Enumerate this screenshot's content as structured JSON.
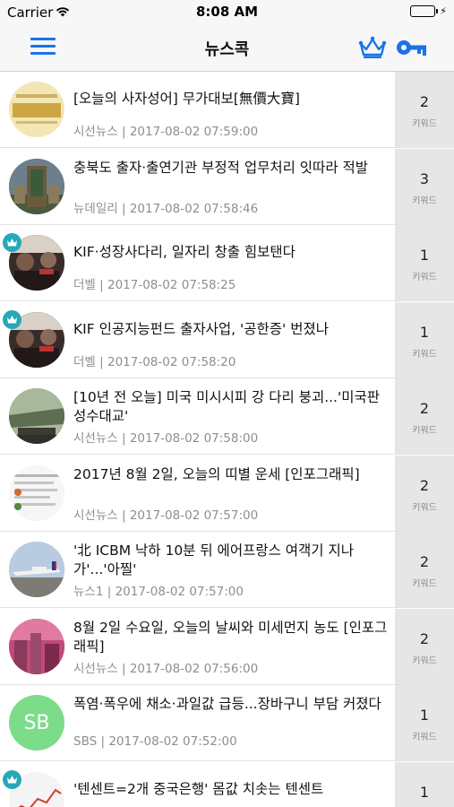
{
  "status_bar": {
    "carrier": "Carrier",
    "time": "8:08 AM"
  },
  "nav": {
    "title": "뉴스콕",
    "menu_icon": "hamburger-menu-icon",
    "crown_icon": "crown-icon",
    "key_icon": "key-icon"
  },
  "colors": {
    "accent": "#1a73e8",
    "badge": "#25a9b8",
    "keyword_bg": "#e6e6e6",
    "meta_text": "#8e8e8e"
  },
  "articles": [
    {
      "title": "[오늘의 사자성어] 무가대보[無價大寶]",
      "source": "시선뉴스",
      "time": "2017-08-02 07:59:00",
      "keyword_count": "2",
      "keyword_label": "키워드",
      "premium": false,
      "thumb_text": "",
      "thumb_bg": "#f3e6b5"
    },
    {
      "title": "충북도 출자·출연기관 부정적 업무처리 잇따라 적발",
      "source": "뉴데일리",
      "time": "2017-08-02 07:58:46",
      "keyword_count": "3",
      "keyword_label": "키워드",
      "premium": false,
      "thumb_text": "",
      "thumb_bg": "#4b5a3e"
    },
    {
      "title": "KIF·성장사다리, 일자리 창출 힘보탠다",
      "source": "더벨",
      "time": "2017-08-02 07:58:25",
      "keyword_count": "1",
      "keyword_label": "키워드",
      "premium": true,
      "thumb_text": "",
      "thumb_bg": "#3a2b2b"
    },
    {
      "title": "KIF 인공지능펀드 출자사업, '공한증' 번졌나",
      "source": "더벨",
      "time": "2017-08-02 07:58:20",
      "keyword_count": "1",
      "keyword_label": "키워드",
      "premium": true,
      "thumb_text": "",
      "thumb_bg": "#3a2b2b"
    },
    {
      "title": "[10년 전 오늘] 미국 미시시피 강 다리 붕괴...'미국판 성수대교'",
      "source": "시선뉴스",
      "time": "2017-08-02 07:58:00",
      "keyword_count": "2",
      "keyword_label": "키워드",
      "premium": false,
      "thumb_text": "",
      "thumb_bg": "#6f8a62"
    },
    {
      "title": "2017년 8월 2일, 오늘의 띠별 운세 [인포그래픽]",
      "source": "시선뉴스",
      "time": "2017-08-02 07:57:00",
      "keyword_count": "2",
      "keyword_label": "키워드",
      "premium": false,
      "thumb_text": "",
      "thumb_bg": "#f2f2f2"
    },
    {
      "title": "'北 ICBM 낙하 10분 뒤 에어프랑스 여객기 지나가'...'아찔'",
      "source": "뉴스1",
      "time": "2017-08-02 07:57:00",
      "keyword_count": "2",
      "keyword_label": "키워드",
      "premium": false,
      "thumb_text": "",
      "thumb_bg": "#9fb6cf"
    },
    {
      "title": "8월 2일 수요일, 오늘의 날씨와 미세먼지 농도 [인포그래픽]",
      "source": "시선뉴스",
      "time": "2017-08-02 07:56:00",
      "keyword_count": "2",
      "keyword_label": "키워드",
      "premium": false,
      "thumb_text": "",
      "thumb_bg": "#c2497a"
    },
    {
      "title": "폭염·폭우에 채소·과일값 급등...장바구니 부담 커졌다",
      "source": "SBS",
      "time": "2017-08-02 07:52:00",
      "keyword_count": "1",
      "keyword_label": "키워드",
      "premium": false,
      "thumb_text": "SB",
      "thumb_bg": "#7ddc8a"
    },
    {
      "title": "'텐센트=2개 중국은행' 몸값 치솟는 텐센트",
      "source": "",
      "time": "",
      "keyword_count": "1",
      "keyword_label": "키워드",
      "premium": true,
      "thumb_text": "",
      "thumb_bg": "#f4f4f4"
    }
  ]
}
